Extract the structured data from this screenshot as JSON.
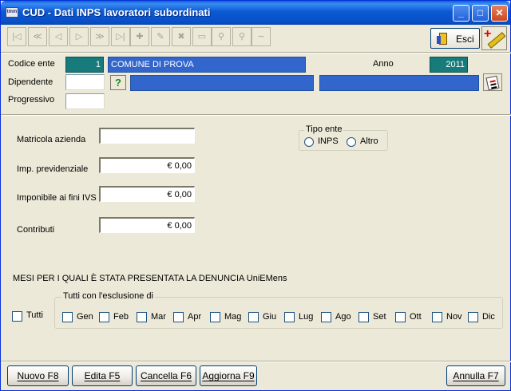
{
  "window": {
    "title": "CUD - Dati INPS lavoratori subordinati",
    "app_icon_text": "tmm"
  },
  "toolbar": {
    "buttons": [
      "first-record",
      "previous-page",
      "previous-record",
      "next-record",
      "next-page",
      "last-record",
      "add-record",
      "edit-record",
      "delete-record",
      "view-record",
      "search",
      "search-advanced",
      "undo"
    ],
    "esci_label": "Esci"
  },
  "header": {
    "codice_ente_label": "Codice ente",
    "codice_ente_value": "1",
    "ente_name": "COMUNE DI PROVA",
    "anno_label": "Anno",
    "anno_value": "2011",
    "dipendente_label": "Dipendente",
    "dipendente_value": "",
    "help_button_label": "?",
    "progressivo_label": "Progressivo",
    "progressivo_value": ""
  },
  "form": {
    "matricola_label": "Matricola azienda",
    "matricola_value": "",
    "imp_prev_label": "Imp. previdenziale",
    "imp_prev_value": "€ 0,00",
    "imponibile_label": "Imponibile ai fini IVS",
    "imponibile_value": "€ 0,00",
    "contributi_label": "Contributi",
    "contributi_value": "€ 0,00",
    "tipo_ente": {
      "legend": "Tipo ente",
      "options": [
        "INPS",
        "Altro"
      ],
      "selected": null
    }
  },
  "mesi": {
    "heading": "MESI PER I QUALI È STATA PRESENTATA LA DENUNCIA UniEMens",
    "tutti_label": "Tutti",
    "group_legend": "Tutti con l'esclusione di",
    "months": [
      "Gen",
      "Feb",
      "Mar",
      "Apr",
      "Mag",
      "Giu",
      "Lug",
      "Ago",
      "Set",
      "Ott",
      "Nov",
      "Dic"
    ]
  },
  "footer": {
    "nuovo": "Nuovo F8",
    "edita": "Edita F5",
    "cancella": "Cancella F6",
    "aggiorna": "Aggiorna F9",
    "annulla": "Annulla F7"
  }
}
